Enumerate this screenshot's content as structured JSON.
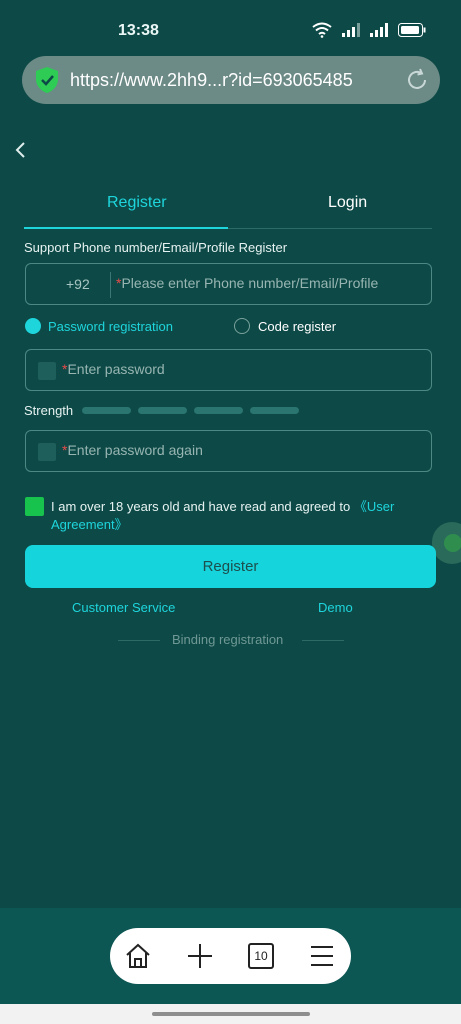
{
  "status_bar": {
    "time": "13:38",
    "icons": [
      "wifi-icon",
      "signal-icon",
      "signal-icon",
      "battery-icon"
    ]
  },
  "browser": {
    "url": "https://www.2hh9...r?id=693065485",
    "icons": [
      "shield-check-icon",
      "refresh-icon"
    ]
  },
  "tabs": {
    "register": "Register",
    "login": "Login"
  },
  "form": {
    "support_text": "Support Phone number/Email/Profile Register",
    "country_code": "+92",
    "phone_placeholder": "Please enter Phone number/Email/Profile",
    "radio_password": "Password registration",
    "radio_code": "Code register",
    "password_placeholder": "Enter password",
    "strength_label": "Strength",
    "password_again_placeholder": "Enter password again",
    "agreement_text": "I am over 18 years old and have read and agreed to",
    "agreement_link": "《User Agreement》",
    "register_button": "Register",
    "customer_service": "Customer Service",
    "demo": "Demo",
    "binding_registration": "Binding registration"
  },
  "bottom_nav": {
    "tab_count": "10",
    "icons": [
      "home-icon",
      "plus-icon",
      "tabs-icon",
      "menu-icon"
    ]
  },
  "colors": {
    "accent": "#1ed5dc",
    "background": "#0d4a47",
    "checkbox": "#17c24d",
    "required_star": "#e84a4a"
  }
}
